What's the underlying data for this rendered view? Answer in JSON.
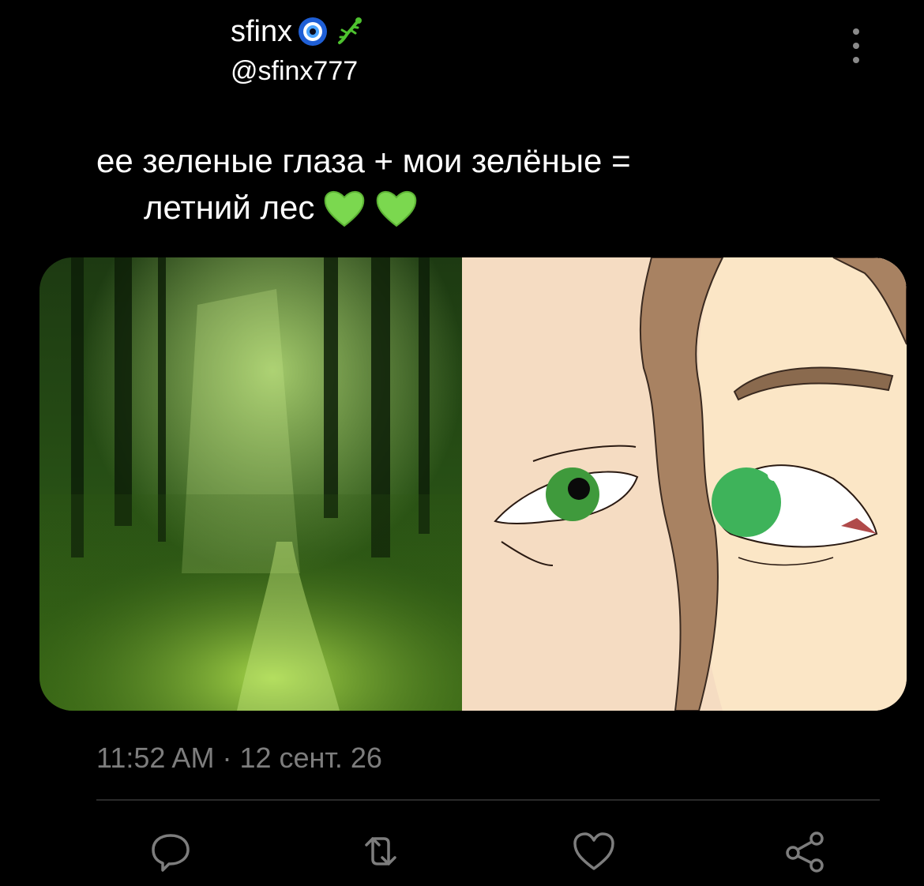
{
  "author": {
    "display_name": "sfinx",
    "handle": "@sfinx777",
    "name_emojis": [
      "nazar-amulet-icon",
      "lizard-icon"
    ]
  },
  "tweet": {
    "line1": "ее зеленые глаза + мои зелёные  =",
    "line2": "летний лес",
    "emojis": [
      "green-heart-icon",
      "green-heart-icon"
    ]
  },
  "media": {
    "left": "forest-photo",
    "right": "drawn-green-eyes-illustration"
  },
  "meta": {
    "time": "11:52 AM",
    "separator": "·",
    "date": "12 сент. 26"
  },
  "actions": [
    "reply-icon",
    "retweet-icon",
    "like-icon",
    "share-icon"
  ],
  "colors": {
    "background": "#000000",
    "text": "#ffffff",
    "muted": "#7d7d7d",
    "heart": "#7bd84f"
  }
}
